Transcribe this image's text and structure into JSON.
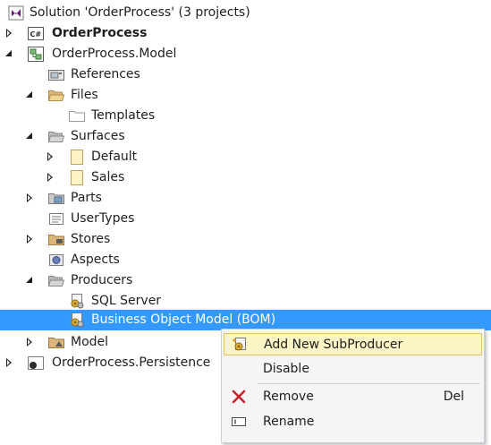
{
  "tree": {
    "items": [
      {
        "label": "Solution 'OrderProcess' (3 projects)",
        "icon": "solution-icon",
        "toggle": "none",
        "bold": false
      },
      {
        "label": "OrderProcess",
        "icon": "csharp-project-icon",
        "toggle": "collapsed",
        "bold": true
      },
      {
        "label": "OrderProcess.Model",
        "icon": "model-project-icon",
        "toggle": "expanded",
        "bold": false
      },
      {
        "label": "References",
        "icon": "references-icon",
        "toggle": "none",
        "bold": false
      },
      {
        "label": "Files",
        "icon": "folder-open-icon",
        "toggle": "expanded",
        "bold": false
      },
      {
        "label": "Templates",
        "icon": "folder-empty-icon",
        "toggle": "none",
        "bold": false
      },
      {
        "label": "Surfaces",
        "icon": "folder-open-icon",
        "toggle": "expanded",
        "bold": false
      },
      {
        "label": "Default",
        "icon": "surface-icon",
        "toggle": "collapsed",
        "bold": false
      },
      {
        "label": "Sales",
        "icon": "surface-icon",
        "toggle": "collapsed",
        "bold": false
      },
      {
        "label": "Parts",
        "icon": "parts-icon",
        "toggle": "collapsed",
        "bold": false
      },
      {
        "label": "UserTypes",
        "icon": "usertypes-icon",
        "toggle": "none",
        "bold": false
      },
      {
        "label": "Stores",
        "icon": "stores-icon",
        "toggle": "collapsed",
        "bold": false
      },
      {
        "label": "Aspects",
        "icon": "aspects-icon",
        "toggle": "none",
        "bold": false
      },
      {
        "label": "Producers",
        "icon": "folder-open-icon",
        "toggle": "expanded",
        "bold": false
      },
      {
        "label": "SQL Server",
        "icon": "producer-icon",
        "toggle": "none",
        "bold": false
      },
      {
        "label": "Business Object Model (BOM)",
        "icon": "producer-icon",
        "toggle": "none",
        "bold": false,
        "selected": true
      },
      {
        "label": "Model",
        "icon": "model-folder-icon",
        "toggle": "collapsed",
        "bold": false
      },
      {
        "label": "OrderProcess.Persistence",
        "icon": "persistence-project-icon",
        "toggle": "collapsed",
        "bold": false
      }
    ]
  },
  "context_menu": {
    "items": [
      {
        "label": "Add New SubProducer",
        "shortcut": "",
        "icon": "add-subproducer-icon",
        "hover": true
      },
      {
        "label": "Disable",
        "shortcut": "",
        "icon": ""
      },
      {
        "label": "Remove",
        "shortcut": "Del",
        "icon": "remove-icon"
      },
      {
        "label": "Rename",
        "shortcut": "",
        "icon": "rename-icon"
      }
    ]
  },
  "colors": {
    "selection": "#3399ff",
    "menu_hover": "#fcf4c4",
    "remove_x": "#c5232b"
  }
}
